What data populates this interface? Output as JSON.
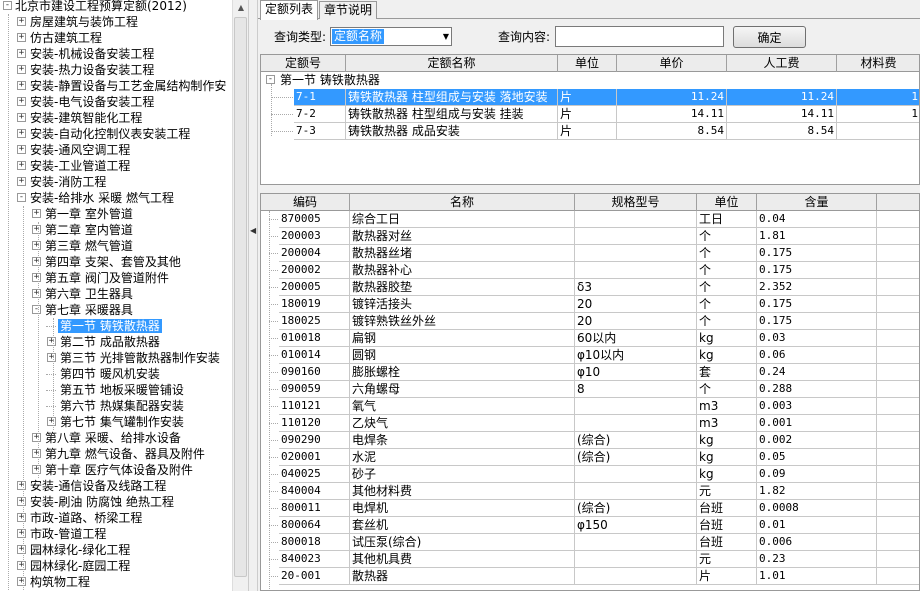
{
  "tree": [
    {
      "label": "北京市建设工程预算定额(2012)",
      "level": 0,
      "exp": "-"
    },
    {
      "label": "房屋建筑与装饰工程",
      "level": 1,
      "exp": "+"
    },
    {
      "label": "仿古建筑工程",
      "level": 1,
      "exp": "+"
    },
    {
      "label": "安装-机械设备安装工程",
      "level": 1,
      "exp": "+"
    },
    {
      "label": "安装-热力设备安装工程",
      "level": 1,
      "exp": "+"
    },
    {
      "label": "安装-静置设备与工艺金属结构制作安",
      "level": 1,
      "exp": "+"
    },
    {
      "label": "安装-电气设备安装工程",
      "level": 1,
      "exp": "+"
    },
    {
      "label": "安装-建筑智能化工程",
      "level": 1,
      "exp": "+"
    },
    {
      "label": "安装-自动化控制仪表安装工程",
      "level": 1,
      "exp": "+"
    },
    {
      "label": "安装-通风空调工程",
      "level": 1,
      "exp": "+"
    },
    {
      "label": "安装-工业管道工程",
      "level": 1,
      "exp": "+"
    },
    {
      "label": "安装-消防工程",
      "level": 1,
      "exp": "+"
    },
    {
      "label": "安装-给排水 采暖 燃气工程",
      "level": 1,
      "exp": "-"
    },
    {
      "label": "第一章 室外管道",
      "level": 2,
      "exp": "+"
    },
    {
      "label": "第二章 室内管道",
      "level": 2,
      "exp": "+"
    },
    {
      "label": "第三章 燃气管道",
      "level": 2,
      "exp": "+"
    },
    {
      "label": "第四章 支架、套管及其他",
      "level": 2,
      "exp": "+"
    },
    {
      "label": "第五章 阀门及管道附件",
      "level": 2,
      "exp": "+"
    },
    {
      "label": "第六章 卫生器具",
      "level": 2,
      "exp": "+"
    },
    {
      "label": "第七章 采暖器具",
      "level": 2,
      "exp": "-"
    },
    {
      "label": "第一节 铸铁散热器",
      "level": 3,
      "exp": "",
      "selected": true
    },
    {
      "label": "第二节 成品散热器",
      "level": 3,
      "exp": "+"
    },
    {
      "label": "第三节 光排管散热器制作安装",
      "level": 3,
      "exp": "+"
    },
    {
      "label": "第四节 暖风机安装",
      "level": 3,
      "exp": ""
    },
    {
      "label": "第五节 地板采暖管铺设",
      "level": 3,
      "exp": ""
    },
    {
      "label": "第六节 热媒集配器安装",
      "level": 3,
      "exp": ""
    },
    {
      "label": "第七节 集气罐制作安装",
      "level": 3,
      "exp": "+"
    },
    {
      "label": "第八章 采暖、给排水设备",
      "level": 2,
      "exp": "+"
    },
    {
      "label": "第九章 燃气设备、器具及附件",
      "level": 2,
      "exp": "+"
    },
    {
      "label": "第十章 医疗气体设备及附件",
      "level": 2,
      "exp": "+"
    },
    {
      "label": "安装-通信设备及线路工程",
      "level": 1,
      "exp": "+"
    },
    {
      "label": "安装-刷油 防腐蚀 绝热工程",
      "level": 1,
      "exp": "+"
    },
    {
      "label": "市政-道路、桥梁工程",
      "level": 1,
      "exp": "+"
    },
    {
      "label": "市政-管道工程",
      "level": 1,
      "exp": "+"
    },
    {
      "label": "园林绿化-绿化工程",
      "level": 1,
      "exp": "+"
    },
    {
      "label": "园林绿化-庭园工程",
      "level": 1,
      "exp": "+"
    },
    {
      "label": "构筑物工程",
      "level": 1,
      "exp": "+"
    }
  ],
  "tabs": [
    "定额列表",
    "章节说明"
  ],
  "query": {
    "type_label": "查询类型:",
    "type_value": "定额名称",
    "content_label": "查询内容:",
    "content_value": "",
    "confirm": "确定"
  },
  "quota_table": {
    "columns": [
      "定额号",
      "定额名称",
      "单位",
      "单价",
      "人工费",
      "材料费"
    ],
    "group": {
      "exp": "-",
      "label": "第一节 铸铁散热器"
    },
    "rows": [
      {
        "code": "7-1",
        "name": "铸铁散热器 柱型组成与安装 落地安装",
        "unit": "片",
        "price": "11.24",
        "labor": "11.24",
        "material": "1",
        "selected": true
      },
      {
        "code": "7-2",
        "name": "铸铁散热器 柱型组成与安装 挂装",
        "unit": "片",
        "price": "14.11",
        "labor": "14.11",
        "material": "1"
      },
      {
        "code": "7-3",
        "name": "铸铁散热器 成品安装",
        "unit": "片",
        "price": "8.54",
        "labor": "8.54",
        "material": ""
      }
    ]
  },
  "resource_table": {
    "columns": [
      "编码",
      "名称",
      "规格型号",
      "单位",
      "含量"
    ],
    "rows": [
      {
        "code": "870005",
        "name": "综合工日",
        "spec": "",
        "unit": "工日",
        "qty": "0.04"
      },
      {
        "code": "200003",
        "name": "散热器对丝",
        "spec": "",
        "unit": "个",
        "qty": "1.81"
      },
      {
        "code": "200004",
        "name": "散热器丝堵",
        "spec": "",
        "unit": "个",
        "qty": "0.175"
      },
      {
        "code": "200002",
        "name": "散热器补心",
        "spec": "",
        "unit": "个",
        "qty": "0.175"
      },
      {
        "code": "200005",
        "name": "散热器胶垫",
        "spec": "δ3",
        "unit": "个",
        "qty": "2.352"
      },
      {
        "code": "180019",
        "name": "镀锌活接头",
        "spec": "20",
        "unit": "个",
        "qty": "0.175"
      },
      {
        "code": "180025",
        "name": "镀锌熟铁丝外丝",
        "spec": "20",
        "unit": "个",
        "qty": "0.175"
      },
      {
        "code": "010018",
        "name": "扁钢",
        "spec": "60以内",
        "unit": "kg",
        "qty": "0.03"
      },
      {
        "code": "010014",
        "name": "圆钢",
        "spec": "φ10以内",
        "unit": "kg",
        "qty": "0.06"
      },
      {
        "code": "090160",
        "name": "膨胀螺栓",
        "spec": "φ10",
        "unit": "套",
        "qty": "0.24"
      },
      {
        "code": "090059",
        "name": "六角螺母",
        "spec": "8",
        "unit": "个",
        "qty": "0.288"
      },
      {
        "code": "110121",
        "name": "氧气",
        "spec": "",
        "unit": "m3",
        "qty": "0.003"
      },
      {
        "code": "110120",
        "name": "乙炔气",
        "spec": "",
        "unit": "m3",
        "qty": "0.001"
      },
      {
        "code": "090290",
        "name": "电焊条",
        "spec": "(综合)",
        "unit": "kg",
        "qty": "0.002"
      },
      {
        "code": "020001",
        "name": "水泥",
        "spec": "(综合)",
        "unit": "kg",
        "qty": "0.05"
      },
      {
        "code": "040025",
        "name": "砂子",
        "spec": "",
        "unit": "kg",
        "qty": "0.09"
      },
      {
        "code": "840004",
        "name": "其他材料费",
        "spec": "",
        "unit": "元",
        "qty": "1.82"
      },
      {
        "code": "800011",
        "name": "电焊机",
        "spec": "(综合)",
        "unit": "台班",
        "qty": "0.0008"
      },
      {
        "code": "800064",
        "name": "套丝机",
        "spec": "φ150",
        "unit": "台班",
        "qty": "0.01"
      },
      {
        "code": "800018",
        "name": "试压泵(综合)",
        "spec": "",
        "unit": "台班",
        "qty": "0.006"
      },
      {
        "code": "840023",
        "name": "其他机具费",
        "spec": "",
        "unit": "元",
        "qty": "0.23"
      },
      {
        "code": "20-001",
        "name": "散热器",
        "spec": "",
        "unit": "片",
        "qty": "1.01"
      }
    ]
  }
}
